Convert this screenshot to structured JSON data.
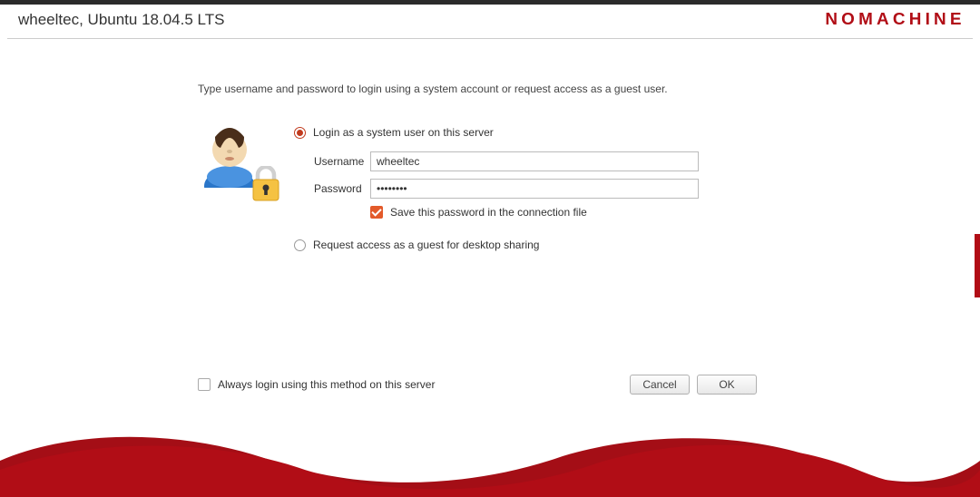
{
  "header": {
    "title": "wheeltec, Ubuntu 18.04.5 LTS",
    "brand": "NOMACHINE"
  },
  "instruction": "Type username and password to login using a system account or request access as a guest user.",
  "login": {
    "radio_system_label": "Login as a system user on this server",
    "radio_guest_label": "Request access as a guest for desktop sharing",
    "username_label": "Username",
    "username_value": "wheeltec",
    "password_label": "Password",
    "password_value": "••••••••",
    "save_password_label": "Save this password in the connection file"
  },
  "footer": {
    "always_login_label": "Always login using this method on this server",
    "cancel_label": "Cancel",
    "ok_label": "OK"
  },
  "colors": {
    "brand_red": "#b10d16",
    "accent_orange": "#e35a2a"
  }
}
